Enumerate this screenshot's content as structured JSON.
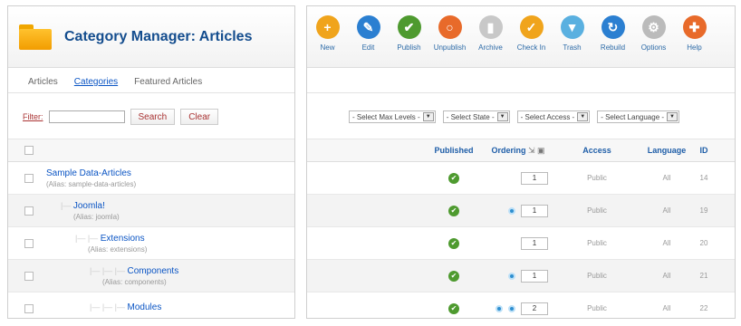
{
  "page_title": "Category Manager: Articles",
  "subnav": [
    "Articles",
    "Categories",
    "Featured Articles"
  ],
  "filter": {
    "label": "Filter:",
    "value": "",
    "search": "Search",
    "clear": "Clear"
  },
  "toolbar": [
    {
      "label": "New",
      "icon": "plus-icon",
      "color": "#f0a41c",
      "glyph": "+"
    },
    {
      "label": "Edit",
      "icon": "pencil-icon",
      "color": "#2b7fd1",
      "glyph": "✎"
    },
    {
      "label": "Publish",
      "icon": "check-icon",
      "color": "#4e9a2f",
      "glyph": "✔"
    },
    {
      "label": "Unpublish",
      "icon": "circle-icon",
      "color": "#e86a2a",
      "glyph": "○"
    },
    {
      "label": "Archive",
      "icon": "archive-icon",
      "color": "#c8c8c8",
      "glyph": "▮"
    },
    {
      "label": "Check In",
      "icon": "checkmark-icon",
      "color": "#f0a41c",
      "glyph": "✓"
    },
    {
      "label": "Trash",
      "icon": "trash-icon",
      "color": "#5ab0e0",
      "glyph": "▼"
    },
    {
      "label": "Rebuild",
      "icon": "rebuild-icon",
      "color": "#2b7fd1",
      "glyph": "↻"
    },
    {
      "label": "Options",
      "icon": "options-icon",
      "color": "#bbbbbb",
      "glyph": "⚙"
    },
    {
      "label": "Help",
      "icon": "help-icon",
      "color": "#e86a2a",
      "glyph": "✚"
    }
  ],
  "selects": [
    "- Select Max Levels -",
    "- Select State -",
    "- Select Access -",
    "- Select Language -"
  ],
  "columns": {
    "published": "Published",
    "ordering": "Ordering",
    "access": "Access",
    "language": "Language",
    "id": "ID"
  },
  "rows": [
    {
      "name": "Sample Data-Articles",
      "alias": "(Alias: sample-data-articles)",
      "depth": 0,
      "arrows": 0,
      "order": "1",
      "access": "Public",
      "language": "All",
      "id": "14"
    },
    {
      "name": "Joomla!",
      "alias": "(Alias: joomla)",
      "depth": 1,
      "arrows": 1,
      "order": "1",
      "access": "Public",
      "language": "All",
      "id": "19"
    },
    {
      "name": "Extensions",
      "alias": "(Alias: extensions)",
      "depth": 2,
      "arrows": 0,
      "order": "1",
      "access": "Public",
      "language": "All",
      "id": "20"
    },
    {
      "name": "Components",
      "alias": "(Alias: components)",
      "depth": 3,
      "arrows": 1,
      "order": "1",
      "access": "Public",
      "language": "All",
      "id": "21"
    },
    {
      "name": "Modules",
      "alias": "",
      "depth": 3,
      "arrows": 2,
      "order": "2",
      "access": "Public",
      "language": "All",
      "id": "22"
    }
  ]
}
